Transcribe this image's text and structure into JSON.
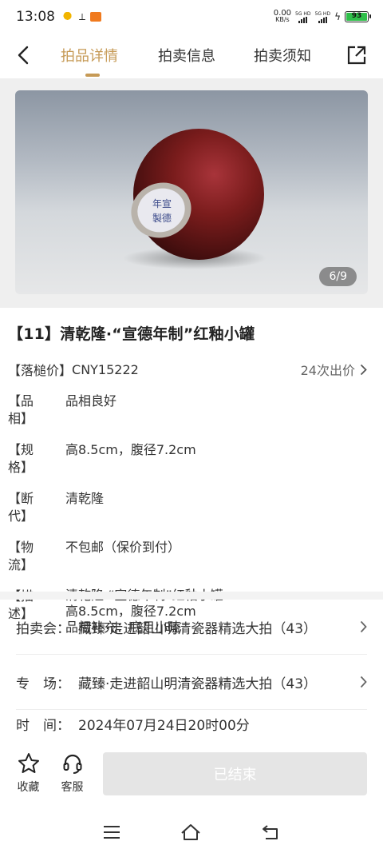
{
  "status_bar": {
    "time": "13:08",
    "net_speed_value": "0.00",
    "net_speed_unit": "KB/s",
    "signal_1": "5G HD",
    "signal_2": "5G HD",
    "battery": "93"
  },
  "nav": {
    "tabs": [
      {
        "label": "拍品详情",
        "active": true
      },
      {
        "label": "拍卖信息",
        "active": false
      },
      {
        "label": "拍卖须知",
        "active": false
      }
    ]
  },
  "image": {
    "counter": "6/9",
    "seal_text": [
      "年宣",
      "製德"
    ]
  },
  "lot": {
    "title": "【11】清乾隆·“宣德年制”红釉小罐",
    "price_label": "【落槌价】",
    "price_value": "CNY15222",
    "bid_count": "24次出价",
    "rows": [
      {
        "key": "【品　相】",
        "value": "品相良好"
      },
      {
        "key": "【规　格】",
        "value": "高8.5cm，腹径7.2cm"
      },
      {
        "key": "【断　代】",
        "value": "清乾隆"
      },
      {
        "key": "【物　流】",
        "value": "不包邮（保价到付）"
      }
    ],
    "desc_key": "【描　述】",
    "desc_lines": [
      "清乾隆·“宣德年制”红釉小罐",
      "高8.5cm，腹径7.2cm",
      "品相补充：底足小磕"
    ]
  },
  "auction_info": {
    "items": [
      {
        "label": "拍卖会：",
        "value": "藏臻·走进韶山明清瓷器精选大拍（43）"
      },
      {
        "label": "专　场：",
        "value": "藏臻·走进韶山明清瓷器精选大拍（43）"
      },
      {
        "label": "时　间：",
        "value": "2024年07月24日20时00分"
      }
    ]
  },
  "action_bar": {
    "favorite_label": "收藏",
    "service_label": "客服",
    "status_button": "已结束"
  },
  "colors": {
    "accent": "#c69a56",
    "glaze": "#7a1c1c",
    "disabled_button": "#e5e5e5"
  }
}
